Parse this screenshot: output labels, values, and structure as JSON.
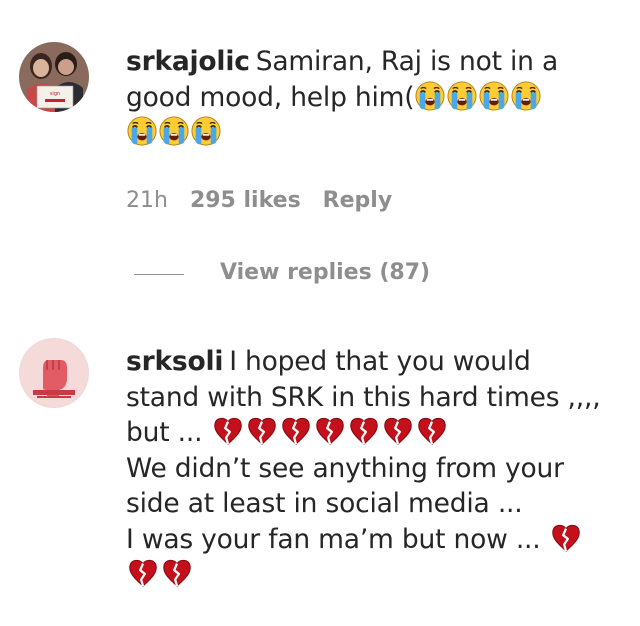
{
  "comments": [
    {
      "username": "srkajolic",
      "text_line1": "Samiran, Raj is not in a",
      "text_line2_prefix": "good mood, help him(",
      "time": "21h",
      "likes": "295 likes",
      "reply": "Reply",
      "avatar_sign": "sign"
    },
    {
      "username": "srksoli",
      "lines": [
        "I hoped that you would",
        "stand with SRK in this hard times ,,,,",
        "but ...",
        "We didn’t see anything from your",
        "side at least in social media ...",
        "I was your fan ma’m but now ..."
      ]
    }
  ],
  "view_replies": "View replies (87)",
  "icons": {
    "crying": "crying-face-emoji",
    "broken_heart": "broken-heart-emoji"
  },
  "colors": {
    "text": "#262626",
    "muted": "#8e8e8e",
    "heart": "#d0021b"
  }
}
